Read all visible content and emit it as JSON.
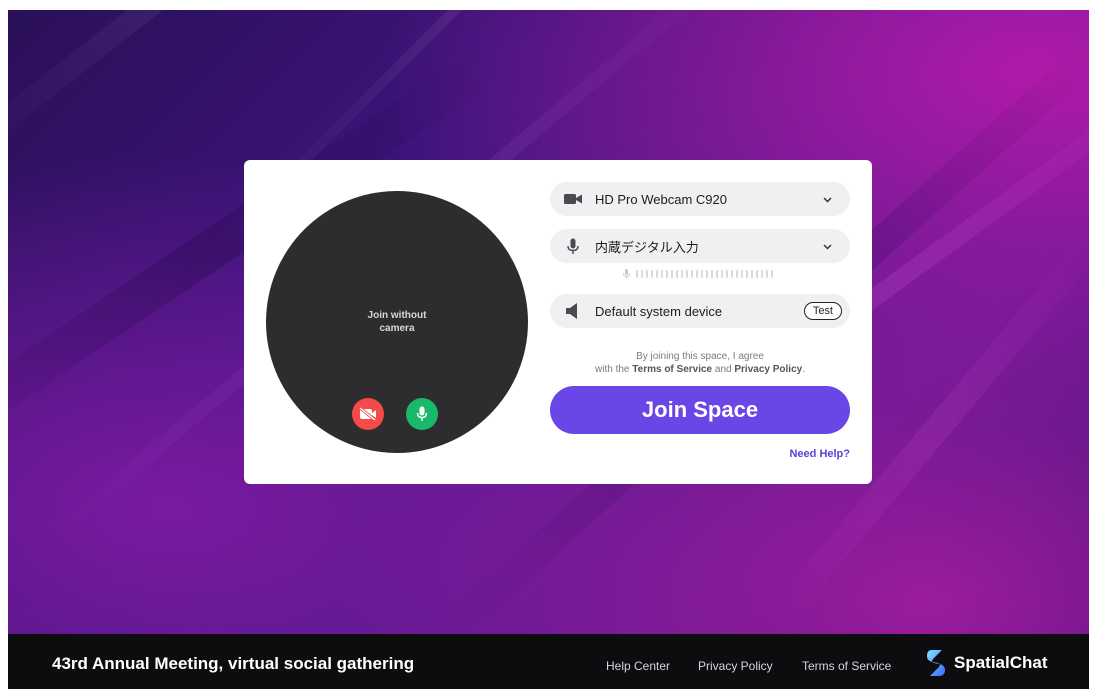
{
  "preview": {
    "no_camera_text": "Join without camera"
  },
  "devices": {
    "camera": {
      "label": "HD Pro Webcam C920",
      "icon": "video-camera-icon"
    },
    "microphone": {
      "label": "内蔵デジタル入力",
      "icon": "microphone-icon"
    },
    "speaker": {
      "label": "Default system device",
      "icon": "speaker-icon",
      "test_label": "Test"
    }
  },
  "terms": {
    "line1": "By joining this space, I agree",
    "line2_prefix": "with the",
    "terms_link": "Terms of Service",
    "and": "and",
    "privacy_link": "Privacy Policy",
    "period": "."
  },
  "join_button": "Join Space",
  "need_help": "Need Help?",
  "footer": {
    "event_title": "43rd Annual Meeting, virtual social gathering",
    "links": [
      "Help Center",
      "Privacy Policy",
      "Terms of Service"
    ],
    "brand": "SpatialChat"
  },
  "colors": {
    "accent": "#6a46e6",
    "camera_off": "#f44a4a",
    "mic_on": "#19b86a",
    "footer_bg": "#0d0d10"
  }
}
